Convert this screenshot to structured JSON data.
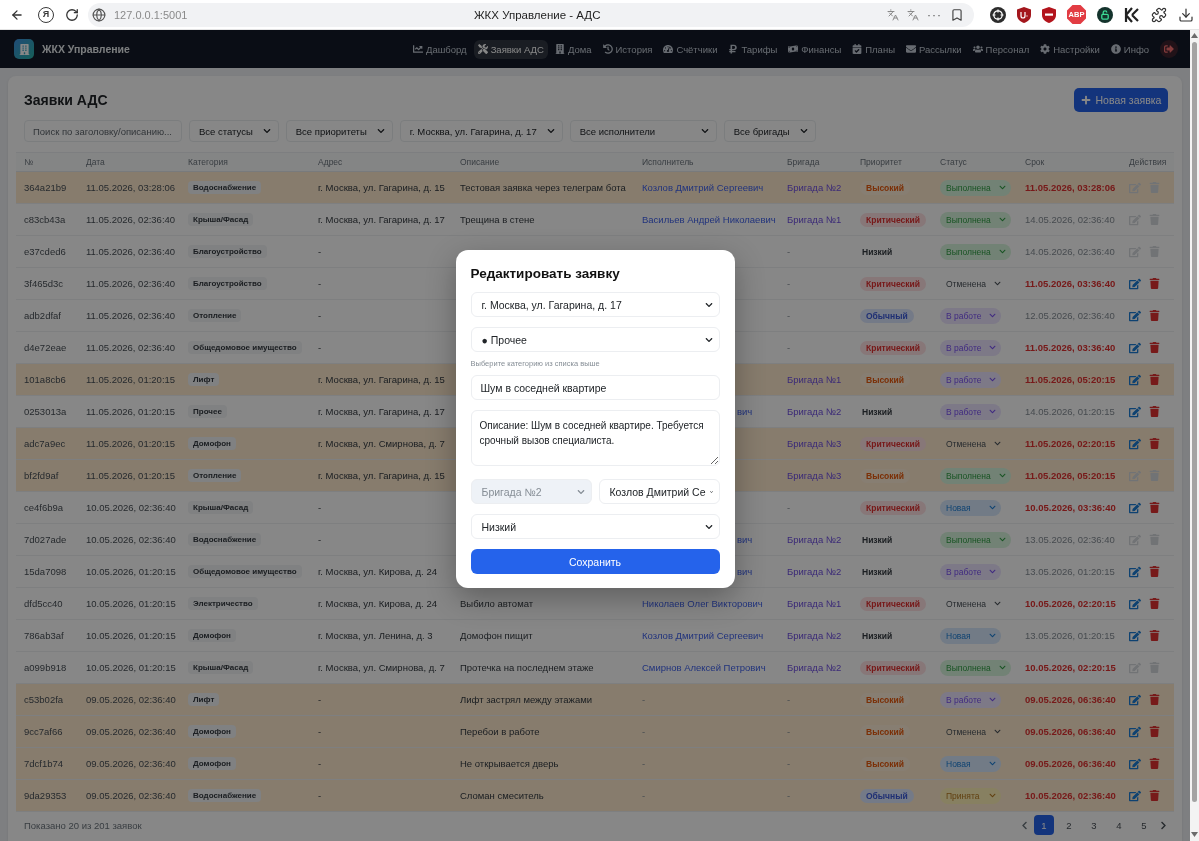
{
  "browser": {
    "logo_letter": "Я",
    "url": "127.0.0.1:5001",
    "title": "ЖКХ Управление - АДС",
    "more": "···",
    "adblock_label": "ABP"
  },
  "nav": {
    "brand": "ЖКХ Управление",
    "items": [
      {
        "label": "Дашборд",
        "selected": false
      },
      {
        "label": "Заявки АДС",
        "selected": true
      },
      {
        "label": "Дома",
        "selected": false
      },
      {
        "label": "История",
        "selected": false
      },
      {
        "label": "Счётчики",
        "selected": false
      },
      {
        "label": "Тарифы",
        "selected": false
      },
      {
        "label": "Финансы",
        "selected": false
      },
      {
        "label": "Планы",
        "selected": false
      },
      {
        "label": "Рассылки",
        "selected": false
      },
      {
        "label": "Персонал",
        "selected": false
      },
      {
        "label": "Настройки",
        "selected": false
      },
      {
        "label": "Инфо",
        "selected": false
      }
    ]
  },
  "page": {
    "title": "Заявки АДС",
    "new_button": "Новая заявка",
    "search": {
      "placeholder": "Поиск по заголовку/описанию..."
    },
    "filters": [
      "Все статусы",
      "Все приоритеты",
      "г. Москва, ул. Гагарина, д. 17",
      "Все исполнители",
      "Все бригады"
    ]
  },
  "table": {
    "columns": [
      "№",
      "Дата",
      "Категория",
      "Адрес",
      "Описание",
      "Исполнитель",
      "Бригада",
      "Приоритет",
      "Статус",
      "Срок",
      "Действия"
    ],
    "rows": [
      {
        "id": "364a21b9",
        "date": "11.05.2026, 03:28:06",
        "category": "Водоснабжение",
        "address": "г. Москва, ул. Гагарина, д. 15",
        "description": "Тестовая заявка через телеграм бота",
        "executor": {
          "text": "Козлов Дмитрий Сергеевич",
          "kind": "link"
        },
        "brigade": {
          "text": "Бригада №2",
          "kind": "link"
        },
        "priority": {
          "label": "Высокий",
          "kind": "high"
        },
        "status": {
          "label": "Выполнена",
          "kind": "done"
        },
        "deadline": "11.05.2026, 03:28:06",
        "overdue": true,
        "highlighted": true,
        "actions_disabled": true
      },
      {
        "id": "c83cb43a",
        "date": "11.05.2026, 02:36:40",
        "category": "Крыша/Фасад",
        "address": "г. Москва, ул. Гагарина, д. 17",
        "description": "Трещина в стене",
        "executor": {
          "text": "Васильев Андрей Николаевич",
          "kind": "link"
        },
        "brigade": {
          "text": "Бригада №1",
          "kind": "link"
        },
        "priority": {
          "label": "Критический",
          "kind": "critical"
        },
        "status": {
          "label": "Выполнена",
          "kind": "done"
        },
        "deadline": "14.05.2026, 02:36:40",
        "overdue": false,
        "highlighted": false,
        "actions_disabled": true
      },
      {
        "id": "e37cded6",
        "date": "11.05.2026, 02:36:40",
        "category": "Благоустройство",
        "address": "-",
        "brigade": {
          "text": "-",
          "kind": "empty"
        },
        "priority": {
          "label": "Низкий",
          "kind": "low"
        },
        "status": {
          "label": "Выполнена",
          "kind": "done"
        },
        "deadline": "14.05.2026, 02:36:40",
        "overdue": false,
        "highlighted": false,
        "actions_disabled": true
      },
      {
        "id": "3f465d3c",
        "date": "11.05.2026, 02:36:40",
        "category": "Благоустройство",
        "address": "-",
        "brigade": {
          "text": "-",
          "kind": "empty"
        },
        "priority": {
          "label": "Критический",
          "kind": "critical"
        },
        "status": {
          "label": "Отменена",
          "kind": "cancelled"
        },
        "deadline": "11.05.2026, 03:36:40",
        "overdue": true,
        "highlighted": false,
        "actions_disabled": false
      },
      {
        "id": "adb2dfaf",
        "date": "11.05.2026, 02:36:40",
        "category": "Отопление",
        "address": "-",
        "brigade": {
          "text": "-",
          "kind": "empty"
        },
        "priority": {
          "label": "Обычный",
          "kind": "normal"
        },
        "status": {
          "label": "В работе",
          "kind": "in_progress"
        },
        "deadline": "12.05.2026, 02:36:40",
        "overdue": false,
        "highlighted": false,
        "actions_disabled": false
      },
      {
        "id": "d4e72eae",
        "date": "11.05.2026, 02:36:40",
        "category": "Общедомовое имущество",
        "address": "-",
        "brigade": {
          "text": "-",
          "kind": "empty"
        },
        "priority": {
          "label": "Критический",
          "kind": "critical"
        },
        "status": {
          "label": "В работе",
          "kind": "in_progress"
        },
        "deadline": "11.05.2026, 03:36:40",
        "overdue": true,
        "highlighted": false,
        "actions_disabled": false
      },
      {
        "id": "101a8cb6",
        "date": "11.05.2026, 01:20:15",
        "category": "Лифт",
        "address": "г. Москва, ул. Гагарина, д. 15",
        "brigade": {
          "text": "Бригада №1",
          "kind": "link"
        },
        "priority": {
          "label": "Высокий",
          "kind": "high"
        },
        "status": {
          "label": "В работе",
          "kind": "in_progress"
        },
        "deadline": "11.05.2026, 05:20:15",
        "overdue": true,
        "highlighted": true,
        "actions_disabled": false
      },
      {
        "id": "0253013a",
        "date": "11.05.2026, 01:20:15",
        "category": "Прочее",
        "address": "г. Москва, ул. Гагарина, д. 17",
        "executor": {
          "text": "вич",
          "kind": "tail"
        },
        "brigade": {
          "text": "Бригада №2",
          "kind": "link"
        },
        "priority": {
          "label": "Низкий",
          "kind": "low"
        },
        "status": {
          "label": "В работе",
          "kind": "in_progress"
        },
        "deadline": "14.05.2026, 01:20:15",
        "overdue": false,
        "highlighted": false,
        "actions_disabled": false
      },
      {
        "id": "adc7a9ec",
        "date": "11.05.2026, 01:20:15",
        "category": "Домофон",
        "address": "г. Москва, ул. Смирнова, д. 7",
        "brigade": {
          "text": "Бригада №3",
          "kind": "link"
        },
        "priority": {
          "label": "Критический",
          "kind": "critical"
        },
        "status": {
          "label": "Отменена",
          "kind": "cancelled"
        },
        "deadline": "11.05.2026, 02:20:15",
        "overdue": true,
        "highlighted": true,
        "actions_disabled": false
      },
      {
        "id": "bf2fd9af",
        "date": "11.05.2026, 01:20:15",
        "category": "Отопление",
        "address": "г. Москва, ул. Гагарина, д. 15",
        "brigade": {
          "text": "Бригада №3",
          "kind": "link"
        },
        "priority": {
          "label": "Высокий",
          "kind": "high"
        },
        "status": {
          "label": "Выполнена",
          "kind": "done"
        },
        "deadline": "11.05.2026, 05:20:15",
        "overdue": true,
        "highlighted": true,
        "actions_disabled": true
      },
      {
        "id": "ce4f6b9a",
        "date": "10.05.2026, 02:36:40",
        "category": "Крыша/Фасад",
        "address": "-",
        "brigade": {
          "text": "-",
          "kind": "empty"
        },
        "priority": {
          "label": "Критический",
          "kind": "critical"
        },
        "status": {
          "label": "Новая",
          "kind": "new"
        },
        "deadline": "10.05.2026, 03:36:40",
        "overdue": true,
        "highlighted": false,
        "actions_disabled": false
      },
      {
        "id": "7d027ade",
        "date": "10.05.2026, 02:36:40",
        "category": "Водоснабжение",
        "address": "-",
        "executor": {
          "text": "вич",
          "kind": "tail"
        },
        "brigade": {
          "text": "Бригада №2",
          "kind": "link"
        },
        "priority": {
          "label": "Низкий",
          "kind": "low"
        },
        "status": {
          "label": "Выполнена",
          "kind": "done"
        },
        "deadline": "13.05.2026, 02:36:40",
        "overdue": false,
        "highlighted": false,
        "actions_disabled": true
      },
      {
        "id": "15da7098",
        "date": "10.05.2026, 01:20:15",
        "category": "Общедомовое имущество",
        "address": "г. Москва, ул. Кирова, д. 24",
        "executor": {
          "text": "вич",
          "kind": "tail"
        },
        "brigade": {
          "text": "Бригада №2",
          "kind": "link"
        },
        "priority": {
          "label": "Низкий",
          "kind": "low"
        },
        "status": {
          "label": "В работе",
          "kind": "in_progress"
        },
        "deadline": "13.05.2026, 01:20:15",
        "overdue": false,
        "highlighted": false,
        "actions_disabled": false
      },
      {
        "id": "dfd5cc40",
        "date": "10.05.2026, 01:20:15",
        "category": "Электричество",
        "address": "г. Москва, ул. Кирова, д. 24",
        "description": "Выбило автомат",
        "executor": {
          "text": "Николаев Олег Викторович",
          "kind": "link"
        },
        "brigade": {
          "text": "Бригада №1",
          "kind": "link"
        },
        "priority": {
          "label": "Критический",
          "kind": "critical"
        },
        "status": {
          "label": "Отменена",
          "kind": "cancelled"
        },
        "deadline": "10.05.2026, 02:20:15",
        "overdue": true,
        "highlighted": false,
        "actions_disabled": false
      },
      {
        "id": "786ab3af",
        "date": "10.05.2026, 01:20:15",
        "category": "Домофон",
        "address": "г. Москва, ул. Ленина, д. 3",
        "description": "Домофон пищит",
        "executor": {
          "text": "Козлов Дмитрий Сергеевич",
          "kind": "link"
        },
        "brigade": {
          "text": "Бригада №2",
          "kind": "link"
        },
        "priority": {
          "label": "Низкий",
          "kind": "low"
        },
        "status": {
          "label": "Новая",
          "kind": "new"
        },
        "deadline": "13.05.2026, 01:20:15",
        "overdue": false,
        "highlighted": false,
        "actions_disabled": false
      },
      {
        "id": "a099b918",
        "date": "10.05.2026, 01:20:15",
        "category": "Крыша/Фасад",
        "address": "г. Москва, ул. Смирнова, д. 7",
        "description": "Протечка на последнем этаже",
        "executor": {
          "text": "Смирнов Алексей Петрович",
          "kind": "link"
        },
        "brigade": {
          "text": "Бригада №2",
          "kind": "link"
        },
        "priority": {
          "label": "Критический",
          "kind": "critical"
        },
        "status": {
          "label": "Выполнена",
          "kind": "done"
        },
        "deadline": "10.05.2026, 02:20:15",
        "overdue": true,
        "highlighted": false,
        "actions_disabled": true
      },
      {
        "id": "c53b02fa",
        "date": "09.05.2026, 02:36:40",
        "category": "Лифт",
        "address": "-",
        "description": "Лифт застрял между этажами",
        "executor": {
          "text": "-",
          "kind": "empty"
        },
        "brigade": {
          "text": "-",
          "kind": "empty"
        },
        "priority": {
          "label": "Высокий",
          "kind": "high"
        },
        "status": {
          "label": "В работе",
          "kind": "in_progress"
        },
        "deadline": "09.05.2026, 06:36:40",
        "overdue": true,
        "highlighted": true,
        "actions_disabled": false
      },
      {
        "id": "9cc7af66",
        "date": "09.05.2026, 02:36:40",
        "category": "Домофон",
        "address": "-",
        "description": "Перебои в работе",
        "executor": {
          "text": "-",
          "kind": "empty"
        },
        "brigade": {
          "text": "-",
          "kind": "empty"
        },
        "priority": {
          "label": "Высокий",
          "kind": "high"
        },
        "status": {
          "label": "Отменена",
          "kind": "cancelled"
        },
        "deadline": "09.05.2026, 06:36:40",
        "overdue": true,
        "highlighted": true,
        "actions_disabled": false
      },
      {
        "id": "7dcf1b74",
        "date": "09.05.2026, 02:36:40",
        "category": "Домофон",
        "address": "-",
        "description": "Не открывается дверь",
        "executor": {
          "text": "-",
          "kind": "empty"
        },
        "brigade": {
          "text": "-",
          "kind": "empty"
        },
        "priority": {
          "label": "Высокий",
          "kind": "high"
        },
        "status": {
          "label": "Новая",
          "kind": "new"
        },
        "deadline": "09.05.2026, 06:36:40",
        "overdue": true,
        "highlighted": true,
        "actions_disabled": false
      },
      {
        "id": "9da29353",
        "date": "09.05.2026, 02:36:40",
        "category": "Водоснабжение",
        "address": "-",
        "description": "Сломан смеситель",
        "executor": {
          "text": "-",
          "kind": "empty"
        },
        "brigade": {
          "text": "-",
          "kind": "empty"
        },
        "priority": {
          "label": "Обычный",
          "kind": "normal"
        },
        "status": {
          "label": "Принята",
          "kind": "accepted"
        },
        "deadline": "10.05.2026, 02:36:40",
        "overdue": true,
        "highlighted": true,
        "actions_disabled": false
      }
    ]
  },
  "footer": {
    "summary": "Показано 20 из 201 заявок",
    "pages": [
      {
        "label": "1",
        "selected": true
      },
      {
        "label": "2",
        "selected": false
      },
      {
        "label": "3",
        "selected": false
      },
      {
        "label": "4",
        "selected": false
      },
      {
        "label": "5",
        "selected": false
      }
    ]
  },
  "modal": {
    "title": "Редактировать заявку",
    "address": "г. Москва, ул. Гагарина, д. 17",
    "category": "● Прочее",
    "category_hint": "Выберите категорию из списка выше",
    "subject": "Шум в соседней квартире",
    "description": "Описание: Шум в соседней квартире. Требуется срочный вызов специалиста.",
    "brigade": {
      "value": "Бригада №2",
      "disabled": true
    },
    "executor": "Козлов Дмитрий Се",
    "priority": "Низкий",
    "save_button": "Сохранить"
  }
}
